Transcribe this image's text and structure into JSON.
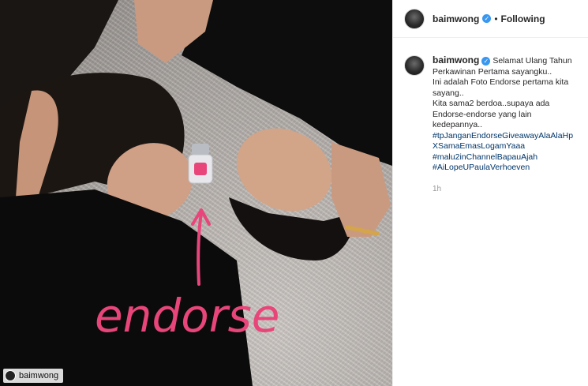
{
  "post": {
    "watermark_username": "baimwong",
    "overlay_text": "endorse"
  },
  "header": {
    "username": "baimwong",
    "separator": "•",
    "follow_label": "Following"
  },
  "caption": {
    "username": "baimwong",
    "line1": "Selamat Ulang Tahun",
    "line2": "Perkawinan Pertama sayangku..",
    "line3": "Ini adalah Foto Endorse pertama kita",
    "line4": "sayang..",
    "line5": "Kita sama2 berdoa..supaya ada",
    "line6": "Endorse-endorse yang lain",
    "line7": "kedepannya..",
    "hashtags": [
      "#tpJanganEndorseGiveawayAlaAlaHp",
      "XSamaEmasLogamYaaa",
      "#malu2inChannelBapauAjah",
      "#AiLopeUPaulaVerhoeven"
    ]
  },
  "timestamp": "1h",
  "colors": {
    "accent_pink": "#e8457a",
    "verified_blue": "#3897f0",
    "hashtag_blue": "#003569"
  }
}
